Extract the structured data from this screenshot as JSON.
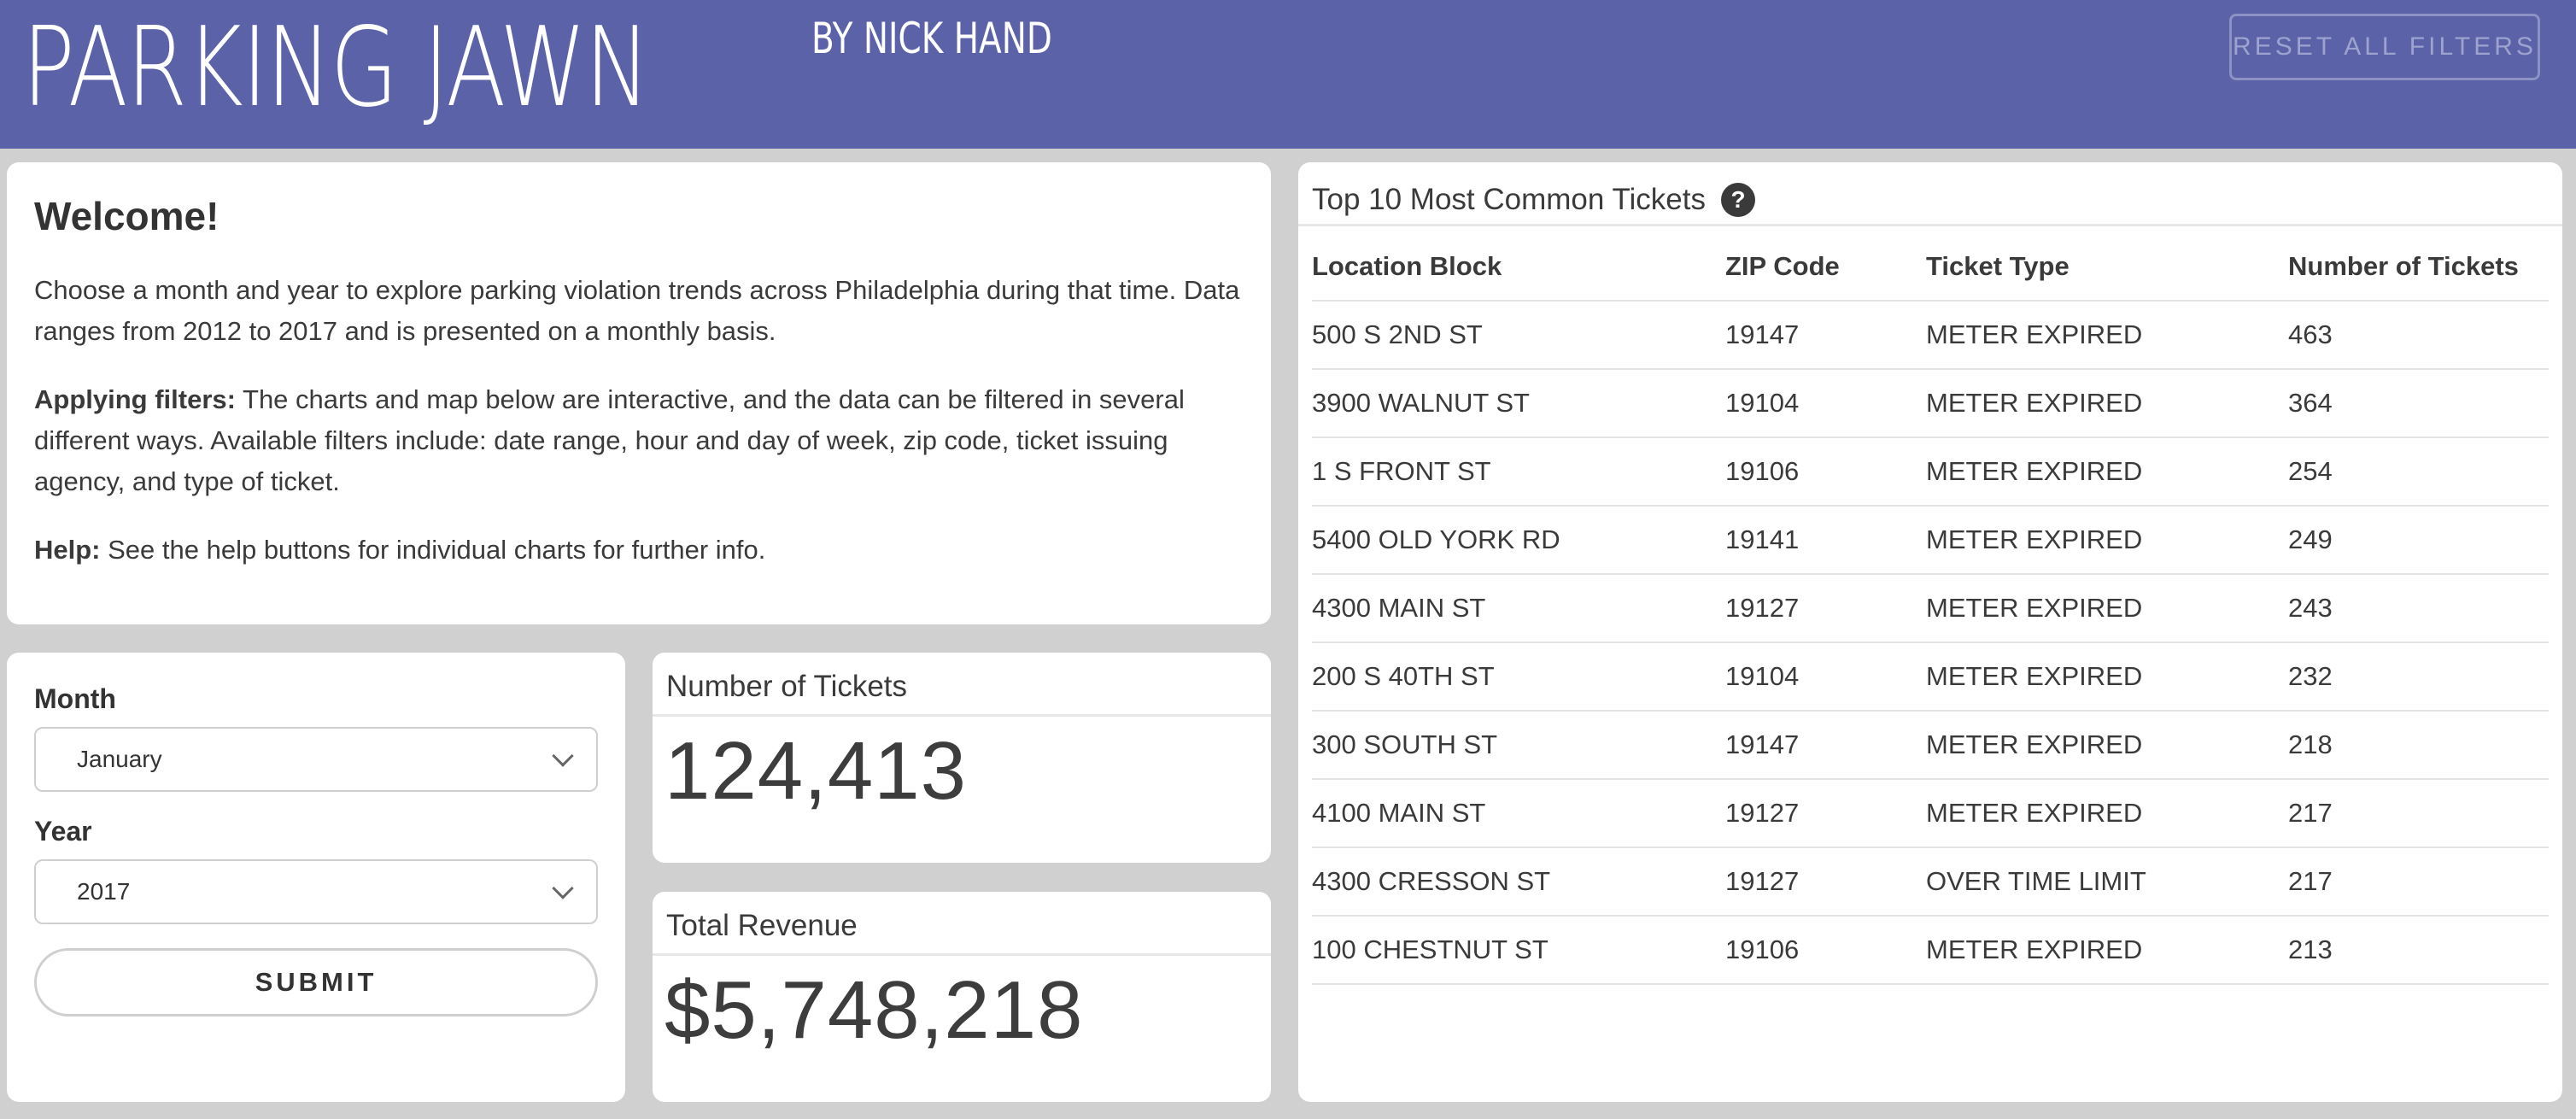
{
  "header": {
    "title": "PARKING JAWN",
    "byline": "BY NICK HAND",
    "reset_label": "RESET ALL FILTERS",
    "background": "#5b62a8"
  },
  "welcome": {
    "heading": "Welcome!",
    "intro": "Choose a month and year to explore parking violation trends across Philadelphia during that time. Data ranges from 2012 to 2017 and is presented on a monthly basis.",
    "filters_label": "Applying filters:",
    "filters_text": " The charts and map below are interactive, and the data can be filtered in several different ways. Available filters include: date range, hour and day of week, zip code, ticket issuing agency, and type of ticket.",
    "help_label": "Help:",
    "help_text": " See the help buttons for individual charts for further info."
  },
  "controls": {
    "month_label": "Month",
    "month_value": "January",
    "year_label": "Year",
    "year_value": "2017",
    "submit_label": "SUBMIT"
  },
  "stats": {
    "tickets_label": "Number of Tickets",
    "tickets_value": "124,413",
    "revenue_label": "Total Revenue",
    "revenue_value": "$5,748,218"
  },
  "top_tickets": {
    "title": "Top 10 Most Common Tickets",
    "help_icon": "?",
    "columns": [
      "Location Block",
      "ZIP Code",
      "Ticket Type",
      "Number of Tickets"
    ],
    "rows": [
      [
        "500 S 2ND ST",
        "19147",
        "METER EXPIRED",
        "463"
      ],
      [
        "3900 WALNUT ST",
        "19104",
        "METER EXPIRED",
        "364"
      ],
      [
        "1 S FRONT ST",
        "19106",
        "METER EXPIRED",
        "254"
      ],
      [
        "5400 OLD YORK RD",
        "19141",
        "METER EXPIRED",
        "249"
      ],
      [
        "4300 MAIN ST",
        "19127",
        "METER EXPIRED",
        "243"
      ],
      [
        "200 S 40TH ST",
        "19104",
        "METER EXPIRED",
        "232"
      ],
      [
        "300 SOUTH ST",
        "19147",
        "METER EXPIRED",
        "218"
      ],
      [
        "4100 MAIN ST",
        "19127",
        "METER EXPIRED",
        "217"
      ],
      [
        "4300 CRESSON ST",
        "19127",
        "OVER TIME LIMIT",
        "217"
      ],
      [
        "100 CHESTNUT ST",
        "19106",
        "METER EXPIRED",
        "213"
      ]
    ]
  }
}
